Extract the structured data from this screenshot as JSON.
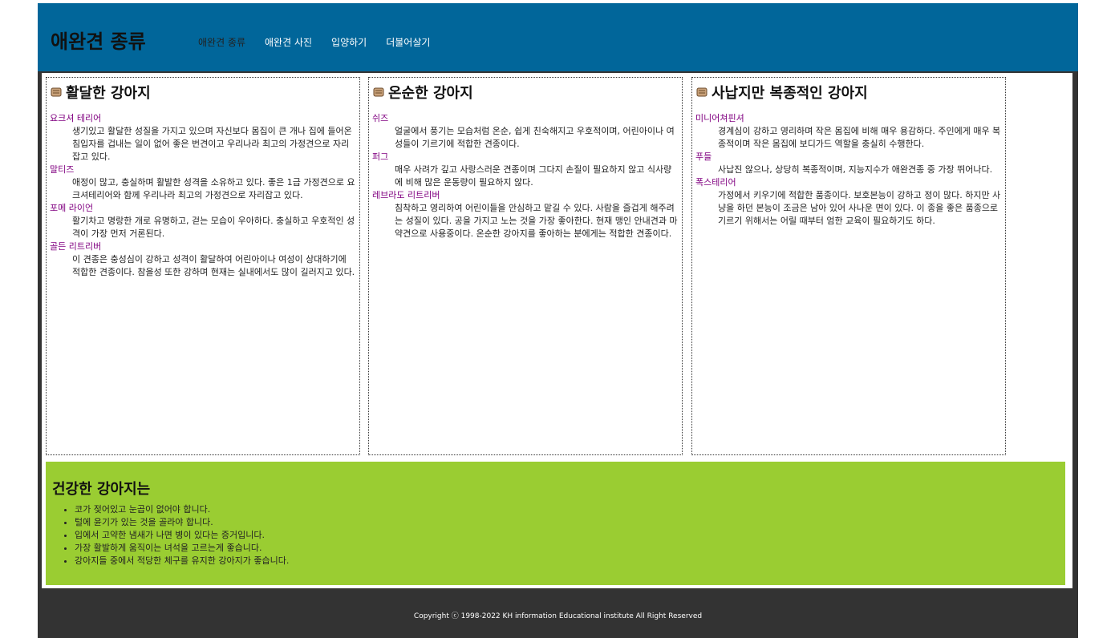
{
  "header": {
    "logo": "애완견 종류",
    "nav": [
      "애완견 종류",
      "애완견 사진",
      "입양하기",
      "더불어살기"
    ]
  },
  "columns": [
    {
      "title": "활달한 강아지",
      "items": [
        {
          "name": "요크셔 테리어",
          "desc": "생기있고 활달한 성질을 가지고 있으며 자신보다 몸집이 큰 개나 집에 들어온 침입자를 겁내는 일이 없어 좋은 번견이고 우리나라 최고의 가정견으로 자리잡고 있다."
        },
        {
          "name": "말티즈",
          "desc": "애정이 많고, 충실하며 활발한 성격을 소유하고 있다. 좋은 1급 가정견으로 요크셔테리어와 함께 우리나라 최고의 가정견으로 자리잡고 있다."
        },
        {
          "name": "포메 라이언",
          "desc": "활기차고 명랑한 개로 유명하고, 걷는 모습이 우아하다. 충실하고 우호적인 성격이 가장 먼저 거론된다."
        },
        {
          "name": "골든 리트리버",
          "desc": "이 견종은 충성심이 강하고 성격이 활달하여 어린아이나 여성이 상대하기에 적합한 견종이다. 참을성 또한 강하며 현재는 실내에서도 많이 길러지고 있다."
        }
      ]
    },
    {
      "title": "온순한 강아지",
      "items": [
        {
          "name": "쉬즈",
          "desc": "얼굴에서 풍기는 모습처럼 온순, 쉽게 친숙해지고 우호적이며, 어린아이나 여성들이 기르기에 적합한 견종이다."
        },
        {
          "name": "퍼그",
          "desc": "매우 사려가 깊고 사랑스러운 견종이며 그다지 손질이 필요하지 않고 식사량에 비해 많은 운동량이 필요하지 않다."
        },
        {
          "name": "레브라도 리트리버",
          "desc": "침착하고 영리하여 어린이들을 안심하고 맡길 수 있다. 사람을 즐겁게 해주려는 성질이 있다. 공을 가지고 노는 것을 가장 좋아한다. 현재 맹인 안내견과 마약견으로 사용중이다. 온순한 강아지를 좋아하는 분에게는 적합한 견종이다."
        }
      ]
    },
    {
      "title": "사납지만 복종적인 강아지",
      "items": [
        {
          "name": "미니어쳐핀셔",
          "desc": "경계심이 강하고 영리하며 작은 몸집에 비해 매우 용감하다. 주인에게 매우 복종적이며 작은 몸집에 보디가드 역할을 충실히 수행한다."
        },
        {
          "name": "푸들",
          "desc": "사납진 않으나, 상당히 복종적이며, 지능지수가 애완견종 중 가장 뛰어나다."
        },
        {
          "name": "폭스테리어",
          "desc": "가정에서 키우기에 적합한 품종이다. 보호본능이 강하고 정이 많다. 하지만 사냥을 하던 본능이 조금은 남아 있어 사나운 면이 있다. 이 종을 좋은 품종으로 기르기 위해서는 어릴 때부터 엄한 교육이 필요하기도 하다."
        }
      ]
    }
  ],
  "health": {
    "title": "건강한 강아지는",
    "items": [
      "코가 젖어있고 눈곱이 없어야 합니다.",
      "털에 윤기가 있는 것을 골라야 합니다.",
      "입에서 고약한 냄새가 나면 병이 있다는 증거입니다.",
      "가장 활발하게 움직이는 녀석을 고르는게 좋습니다.",
      "강아지들 중에서 적당한 체구를 유지한 강아지가 좋습니다."
    ]
  },
  "footer": {
    "copyright": "Copyright ⓒ 1998-2022 KH information Educational institute All Right Reserved"
  },
  "colors": {
    "header_bg": "#01669a",
    "frame_bg": "#333333",
    "health_bg": "#9acd32",
    "link": "#800080"
  },
  "icons": {
    "column_title": "scroll-icon"
  }
}
